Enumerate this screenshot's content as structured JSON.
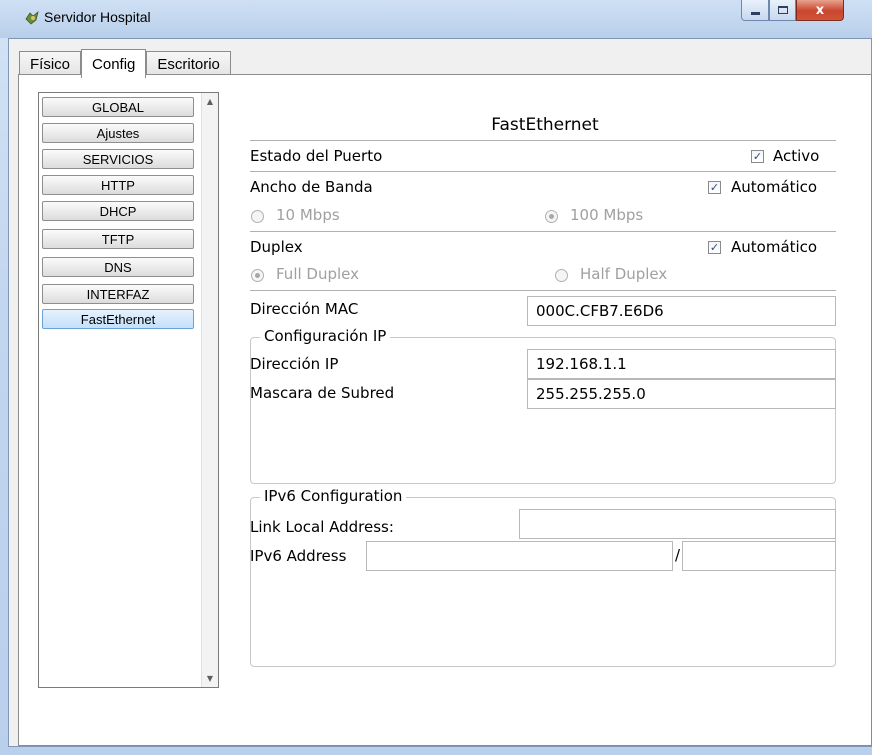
{
  "window": {
    "title": "Servidor Hospital",
    "controls": {
      "minimize": "",
      "maximize": "",
      "close": "x"
    }
  },
  "tabs": [
    {
      "label": "Físico",
      "active": false
    },
    {
      "label": "Config",
      "active": true
    },
    {
      "label": "Escritorio",
      "active": false
    }
  ],
  "sidebar": {
    "items": [
      {
        "label": "GLOBAL"
      },
      {
        "label": "Ajustes"
      },
      {
        "label": "SERVICIOS"
      },
      {
        "label": "HTTP"
      },
      {
        "label": "DHCP"
      },
      {
        "label": "TFTP"
      },
      {
        "label": "DNS"
      },
      {
        "label": "INTERFAZ"
      },
      {
        "label": "FastEthernet"
      }
    ],
    "selected": "FastEthernet"
  },
  "panel": {
    "title": "FastEthernet",
    "port_status": {
      "label": "Estado del Puerto",
      "checkbox_label": "Activo",
      "checked": true
    },
    "bandwidth": {
      "label": "Ancho de Banda",
      "checkbox_label": "Automático",
      "checked": true,
      "options": [
        "10 Mbps",
        "100 Mbps"
      ],
      "selected": "100 Mbps"
    },
    "duplex": {
      "label": "Duplex",
      "checkbox_label": "Automático",
      "checked": true,
      "options": [
        "Full Duplex",
        "Half Duplex"
      ],
      "selected": "Full Duplex"
    },
    "mac": {
      "label": "Dirección MAC",
      "value": "000C.CFB7.E6D6"
    },
    "ip_config": {
      "legend": "Configuración IP",
      "ip": {
        "label": "Dirección IP",
        "value": "192.168.1.1"
      },
      "mask": {
        "label": "Mascara de Subred",
        "value": "255.255.255.0"
      }
    },
    "ipv6": {
      "legend": "IPv6 Configuration",
      "link_local": {
        "label": "Link Local Address:",
        "value": ""
      },
      "address": {
        "label": "IPv6 Address",
        "value": "",
        "separator": "/",
        "prefix": ""
      }
    }
  },
  "colors": {
    "title_bar": "#c3d6ef",
    "close_button": "#c9452d",
    "selected_item": "#c3e0fa"
  }
}
